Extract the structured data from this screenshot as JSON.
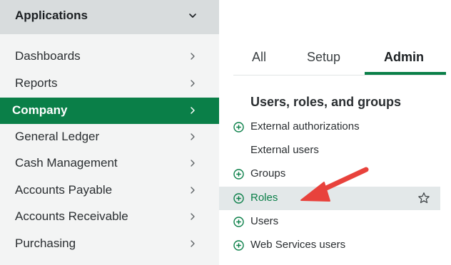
{
  "sidebar": {
    "header": {
      "title": "Applications",
      "chevron_icon": "chevron-down-icon"
    },
    "items": [
      {
        "label": "Dashboards",
        "active": false
      },
      {
        "label": "Reports",
        "active": false
      },
      {
        "label": "Company",
        "active": true
      },
      {
        "label": "General Ledger",
        "active": false
      },
      {
        "label": "Cash Management",
        "active": false
      },
      {
        "label": "Accounts Payable",
        "active": false
      },
      {
        "label": "Accounts Receivable",
        "active": false
      },
      {
        "label": "Purchasing",
        "active": false
      }
    ]
  },
  "tabs": [
    {
      "label": "All",
      "active": false
    },
    {
      "label": "Setup",
      "active": false
    },
    {
      "label": "Admin",
      "active": true
    }
  ],
  "section": {
    "title": "Users, roles, and groups",
    "links": [
      {
        "label": "External authorizations",
        "has_add": true
      },
      {
        "label": "External users",
        "has_add": false
      },
      {
        "label": "Groups",
        "has_add": true
      },
      {
        "label": "Roles",
        "has_add": true,
        "highlighted": true,
        "favorite_icon": "star-outline-icon"
      },
      {
        "label": "Users",
        "has_add": true
      },
      {
        "label": "Web Services users",
        "has_add": true
      }
    ]
  },
  "colors": {
    "accent": "#0a7f48",
    "sidebar_bg": "#f3f4f4",
    "header_bg": "#d8dcdd",
    "highlight_bg": "#e3e8e9",
    "annotation_arrow": "#e8423c"
  }
}
